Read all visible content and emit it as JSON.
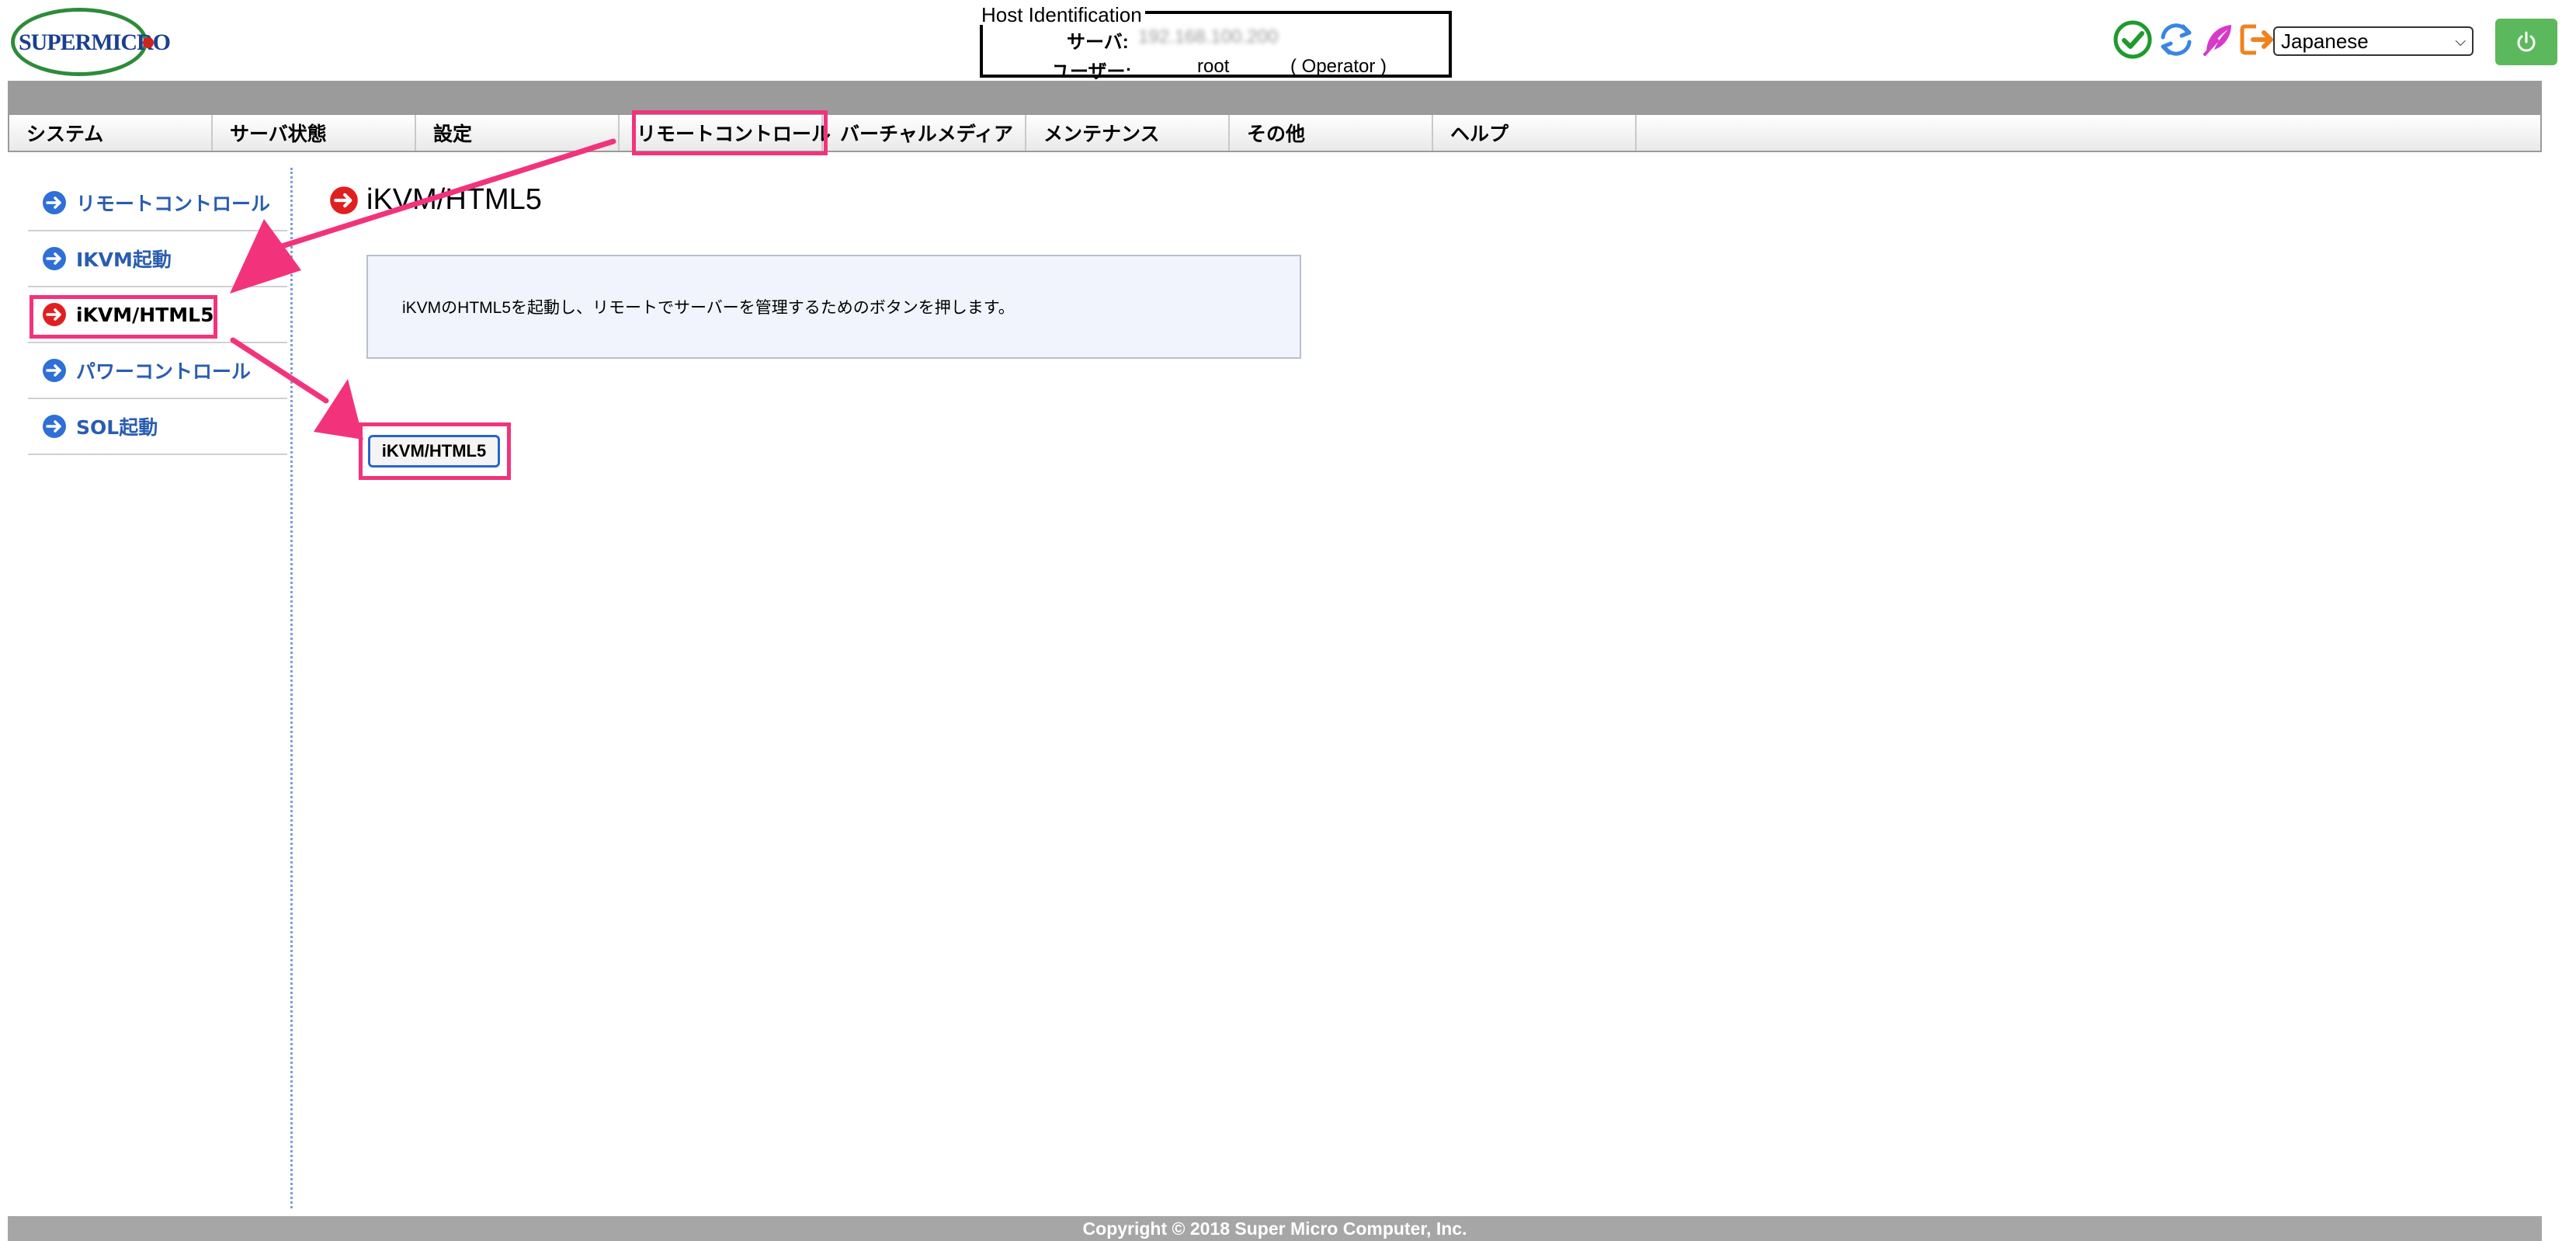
{
  "brand": {
    "logo_text": "SUPERMICRO"
  },
  "host": {
    "legend": "Host Identification",
    "server_label": "サーバ:",
    "server_value": "192.168.100.200",
    "user_label": "ユーザー:",
    "user_value": "root",
    "role": "( Operator )"
  },
  "toolbar": {
    "language": "Japanese",
    "icons": [
      "check-icon",
      "refresh-icon",
      "feather-icon",
      "logout-icon",
      "power-icon"
    ]
  },
  "nav": {
    "items": [
      "システム",
      "サーバ状態",
      "設定",
      "リモートコントロール",
      "バーチャルメディア",
      "メンテナンス",
      "その他",
      "ヘルプ"
    ]
  },
  "sidebar": {
    "items": [
      "リモートコントロール",
      "IKVM起動",
      "iKVM/HTML5",
      "パワーコントロール",
      "SOL起動"
    ]
  },
  "main": {
    "title": "iKVM/HTML5",
    "description": "iKVMのHTML5を起動し、リモートでサーバーを管理するためのボタンを押します。",
    "button_label": "iKVM/HTML5"
  },
  "footer": {
    "text": "Copyright © 2018 Super Micro Computer, Inc."
  },
  "colors": {
    "highlight": "#f2337c",
    "link": "#2a5db0",
    "power": "#5cb85c"
  }
}
